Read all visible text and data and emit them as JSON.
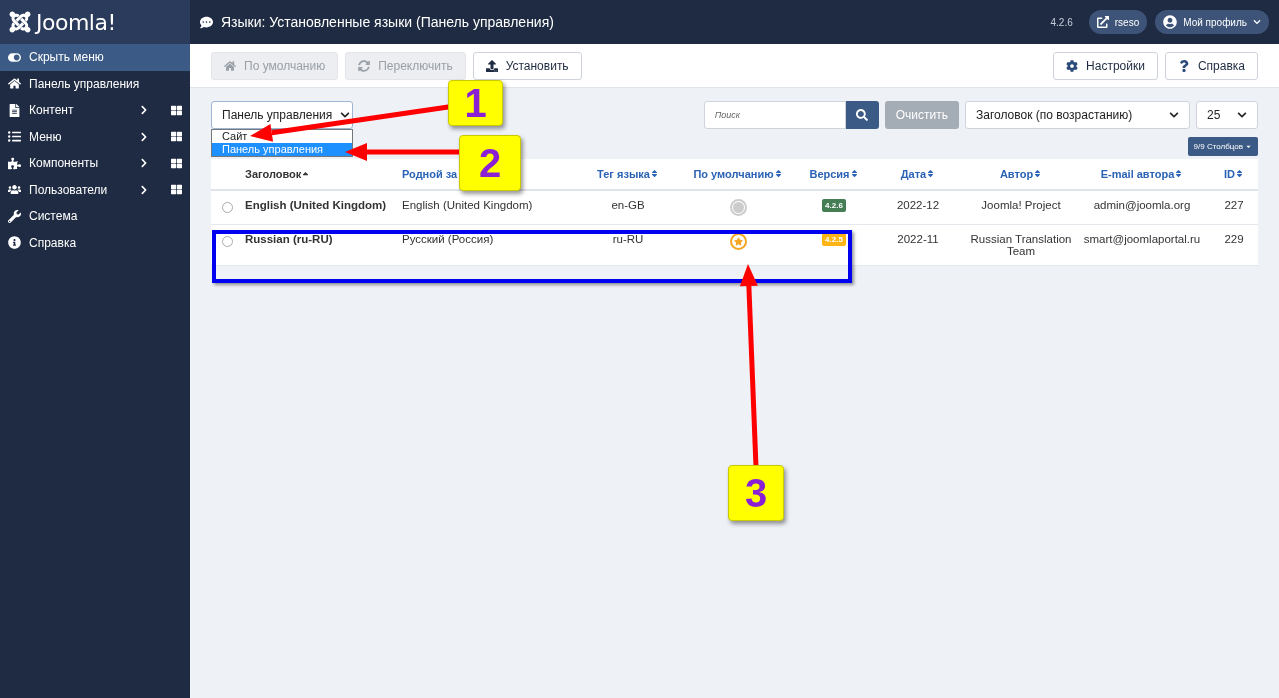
{
  "brand": {
    "name": "Joomla!"
  },
  "header": {
    "title": "Языки: Установленные языки (Панель управления)",
    "version": "4.2.6",
    "site_button": "rseso",
    "profile_button": "Мой профиль"
  },
  "sidebar": {
    "items": [
      {
        "label": "Скрыть меню",
        "kind": "toggle",
        "selected": true,
        "has_submenu": false
      },
      {
        "label": "Панель управления",
        "kind": "home",
        "selected": false,
        "has_submenu": false
      },
      {
        "label": "Контент",
        "kind": "file",
        "selected": false,
        "has_submenu": true
      },
      {
        "label": "Меню",
        "kind": "list",
        "selected": false,
        "has_submenu": true
      },
      {
        "label": "Компоненты",
        "kind": "puzzle",
        "selected": false,
        "has_submenu": true
      },
      {
        "label": "Пользователи",
        "kind": "users",
        "selected": false,
        "has_submenu": true
      },
      {
        "label": "Система",
        "kind": "wrench",
        "selected": false,
        "has_submenu": false
      },
      {
        "label": "Справка",
        "kind": "info",
        "selected": false,
        "has_submenu": false
      }
    ]
  },
  "toolbar": {
    "left": [
      {
        "label": "По умолчанию",
        "kind": "home",
        "disabled": true
      },
      {
        "label": "Переключить",
        "kind": "sync",
        "disabled": true
      },
      {
        "label": "Установить",
        "kind": "upload",
        "disabled": false
      }
    ],
    "right": [
      {
        "label": "Настройки",
        "kind": "gear"
      },
      {
        "label": "Справка",
        "kind": "help"
      }
    ]
  },
  "filters": {
    "client_select": {
      "value": "Панель управления",
      "options": [
        {
          "label": "Сайт",
          "selected": false
        },
        {
          "label": "Панель управления",
          "selected": true
        }
      ]
    },
    "search": {
      "placeholder": "Поиск"
    },
    "clear_button": "Очистить",
    "ordering": "Заголовок (по возрастанию)",
    "limit": "25",
    "columns_button": "9/9 Столбцов"
  },
  "table": {
    "columns": [
      {
        "label": "Заголовок",
        "sortable": true,
        "sorted": true
      },
      {
        "label": "Родной за",
        "sortable": false,
        "sorted": false
      },
      {
        "label": "Тег языка",
        "sortable": true,
        "sorted": false
      },
      {
        "label": "По умолчанию",
        "sortable": true,
        "sorted": false
      },
      {
        "label": "Версия",
        "sortable": true,
        "sorted": false
      },
      {
        "label": "Дата",
        "sortable": true,
        "sorted": false
      },
      {
        "label": "Автор",
        "sortable": true,
        "sorted": false
      },
      {
        "label": "E-mail автора",
        "sortable": true,
        "sorted": false
      },
      {
        "label": "ID",
        "sortable": true,
        "sorted": false
      }
    ],
    "rows": [
      {
        "selected": false,
        "title": "English (United Kingdom)",
        "native": "English (United Kingdom)",
        "tag": "en-GB",
        "default": false,
        "version": "4.2.6",
        "color": "#457d54",
        "date": "2022-12",
        "author": "Joomla! Project",
        "email": "admin@joomla.org",
        "id": "227"
      },
      {
        "selected": false,
        "title": "Russian (ru-RU)",
        "native": "Русский (Россия)",
        "tag": "ru-RU",
        "default": true,
        "version": "4.2.5",
        "color": "#ffb514",
        "date": "2022-11",
        "author": "Russian Translation Team",
        "email": "smart@joomlaportal.ru",
        "id": "229"
      }
    ]
  },
  "annotations": [
    {
      "label": "1"
    },
    {
      "label": "2"
    },
    {
      "label": "3"
    }
  ]
}
